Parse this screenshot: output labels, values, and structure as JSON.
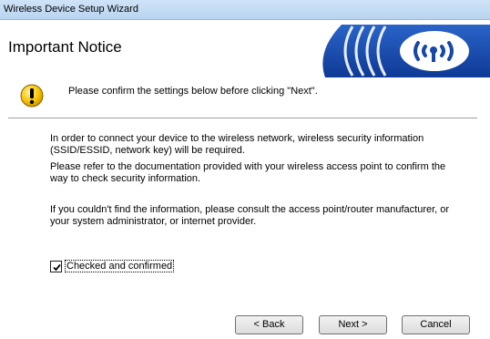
{
  "window": {
    "title": "Wireless Device Setup Wizard"
  },
  "header": {
    "heading": "Important Notice"
  },
  "notice": {
    "text": "Please confirm the settings below before clicking \"Next\"."
  },
  "body": {
    "para1_line1": "In order to connect your device to the wireless network, wireless security information",
    "para1_line2": "(SSID/ESSID, network key) will be required.",
    "para2_line1": "Please refer to the documentation provided with your wireless access point to confirm the",
    "para2_line2": "way to check security information.",
    "para3_line1": "If you couldn't find the information, please consult the access point/router manufacturer, or",
    "para3_line2": "your system administrator, or internet provider."
  },
  "checkbox": {
    "label": "Checked and confirmed",
    "checked": true
  },
  "buttons": {
    "back": "< Back",
    "next": "Next >",
    "cancel": "Cancel"
  },
  "colors": {
    "banner_blue": "#1747a8",
    "titlebar": "#c4dcf4",
    "warning_yellow": "#f5c400"
  },
  "icons": {
    "banner": "wireless-signal-icon",
    "notice": "warning-icon"
  }
}
